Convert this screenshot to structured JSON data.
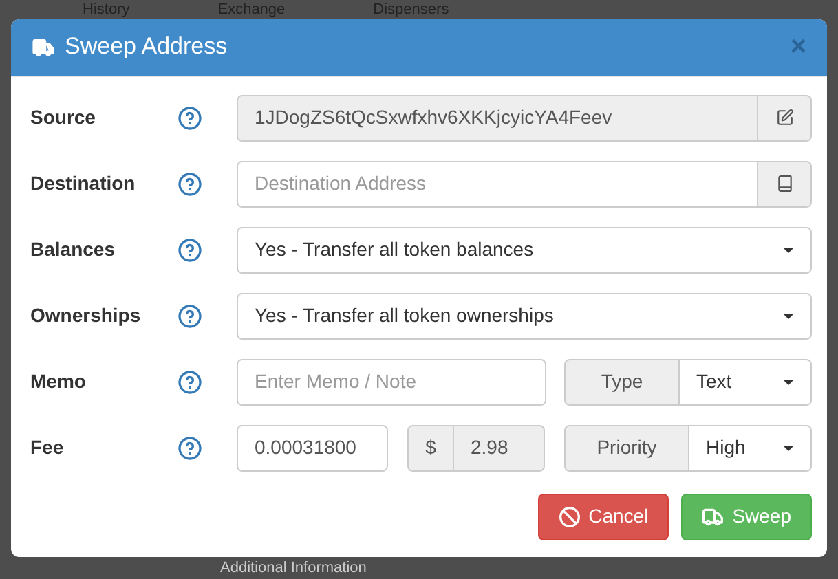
{
  "background": {
    "nav_tabs": [
      "History",
      "Exchange",
      "Dispensers"
    ],
    "section_title": "Additional Information"
  },
  "dialog": {
    "title": "Sweep Address",
    "close": "×"
  },
  "fields": [
    {
      "kind": "locked",
      "label": "Source",
      "value": "1JDogZS6tQcSxwfxhv6XKKjcyicYA4Feev",
      "readonly": true
    },
    {
      "kind": "lookup",
      "label": "Destination",
      "placeholder": "Destination Address",
      "readonly": false
    },
    {
      "kind": "select",
      "label": "Balances",
      "value": "Yes - Transfer all token balances"
    },
    {
      "kind": "select",
      "label": "Ownerships",
      "value": "Yes - Transfer all token ownerships"
    },
    {
      "kind": "memo",
      "label": "Memo",
      "placeholder": "Enter Memo / Note",
      "type_label": "Type",
      "type_value": "Text"
    },
    {
      "kind": "fee",
      "label": "Fee",
      "value": "0.00031800",
      "currency": "$",
      "usd": "2.98",
      "priority_label": "Priority",
      "priority_value": "High"
    }
  ],
  "buttons": [
    {
      "kind": "cancel",
      "label": "Cancel"
    },
    {
      "kind": "sweep",
      "label": "Sweep"
    }
  ]
}
